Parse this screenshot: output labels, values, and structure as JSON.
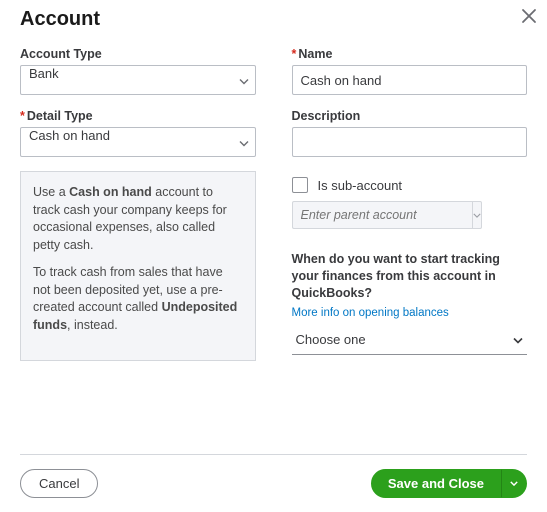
{
  "title": "Account",
  "left": {
    "accountTypeLabel": "Account Type",
    "accountTypeValue": "Bank",
    "detailTypeLabel": "Detail Type",
    "detailTypeValue": "Cash on hand"
  },
  "right": {
    "nameLabel": "Name",
    "nameValue": "Cash on hand",
    "descriptionLabel": "Description",
    "descriptionValue": "",
    "isSubAccountLabel": "Is sub-account",
    "parentPlaceholder": "Enter parent account",
    "trackingQuestion": "When do you want to start tracking your finances from this account in QuickBooks?",
    "infoLink": "More info on opening balances",
    "chooseOne": "Choose one"
  },
  "help": {
    "p1a": "Use a ",
    "p1b": "Cash on hand",
    "p1c": " account to track cash your company keeps for occasional expenses, also called petty cash.",
    "p2a": "To track cash from sales that have not been deposited yet, use a pre-created account called ",
    "p2b": "Undeposited funds",
    "p2c": ", instead."
  },
  "footer": {
    "cancel": "Cancel",
    "save": "Save and Close"
  }
}
